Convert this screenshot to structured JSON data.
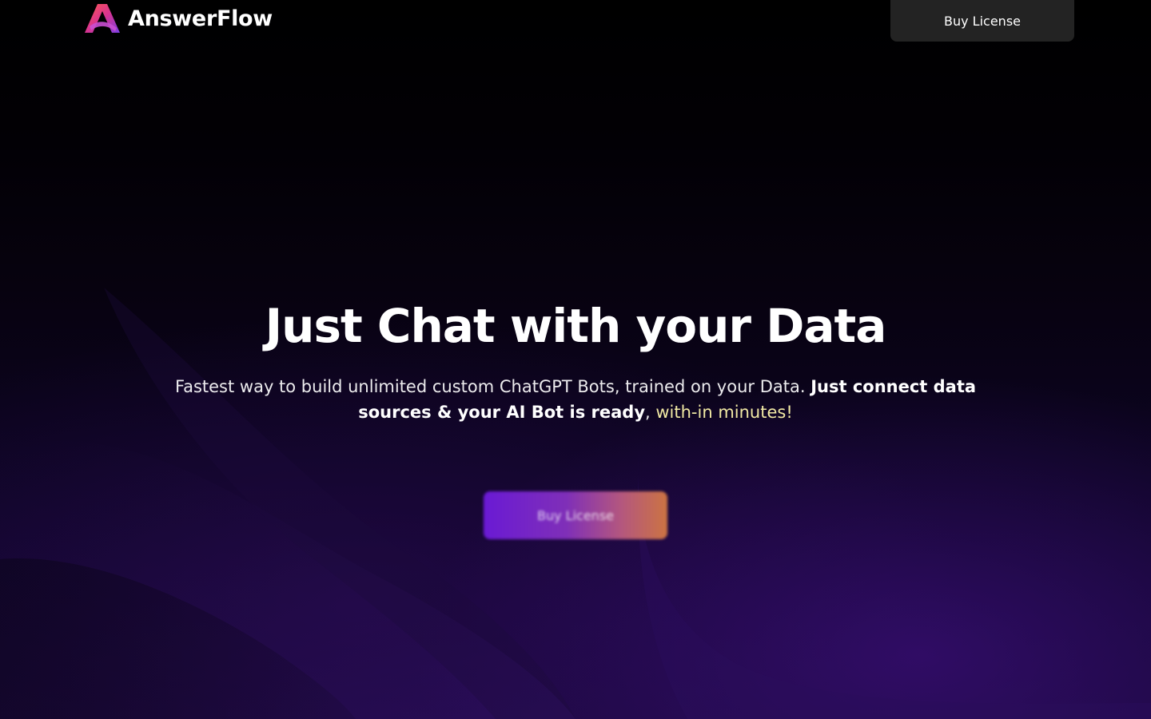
{
  "header": {
    "brand": "AnswerFlow",
    "logo_icon": "answerflow-logo-icon",
    "nav_button_label": "Buy License"
  },
  "hero": {
    "title": "Just Chat with your Data",
    "subtitle": {
      "part1": "Fastest way to build unlimited custom ChatGPT Bots, trained on your Data. ",
      "part2": "Just connect data sources & your AI Bot is ready",
      "part3": ", ",
      "part4": "with-in minutes!"
    },
    "cta_label": "Buy License"
  },
  "colors": {
    "background": "#000000",
    "nav_button_bg": "#232323",
    "accent_text": "#f1e9a4",
    "cta_gradient_start": "#6a1ad4",
    "cta_gradient_end": "#cc7442"
  }
}
